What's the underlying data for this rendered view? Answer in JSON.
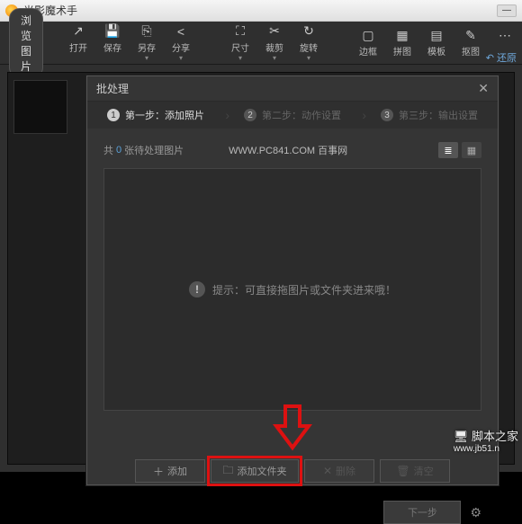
{
  "titlebar": {
    "app_name": "光影魔术手"
  },
  "topbar": {
    "browse": "浏览图片",
    "tools": [
      {
        "icon": "↗",
        "label": "打开"
      },
      {
        "icon": "💾",
        "label": "保存"
      },
      {
        "icon": "⎘",
        "label": "另存"
      },
      {
        "icon": "<",
        "label": "分享"
      }
    ],
    "tools2": [
      {
        "icon": "⛶",
        "label": "尺寸"
      },
      {
        "icon": "✂",
        "label": "裁剪"
      },
      {
        "icon": "↻",
        "label": "旋转"
      }
    ],
    "tools3": [
      {
        "icon": "▢",
        "label": "边框"
      },
      {
        "icon": "▦",
        "label": "拼图"
      },
      {
        "icon": "▤",
        "label": "模板"
      },
      {
        "icon": "✎",
        "label": "抠图"
      },
      {
        "icon": "⋯",
        "label": ""
      }
    ],
    "restore": "还原"
  },
  "dialog": {
    "title": "批处理",
    "steps": [
      {
        "num": "1",
        "label": "第一步：添加照片"
      },
      {
        "num": "2",
        "label": "第二步：动作设置"
      },
      {
        "num": "3",
        "label": "第三步：输出设置"
      }
    ],
    "count_prefix": "共",
    "count": "0",
    "count_suffix": "张待处理图片",
    "watermark": "WWW.PC841.COM 百事网",
    "hint": "提示：可直接拖图片或文件夹进来哦！",
    "buttons": {
      "add": "添加",
      "add_folder": "添加文件夹",
      "delete": "删除",
      "clear": "清空"
    },
    "next": "下一步"
  },
  "site_watermark": {
    "cn": "脚本之家",
    "url": "www.jb51.n"
  }
}
